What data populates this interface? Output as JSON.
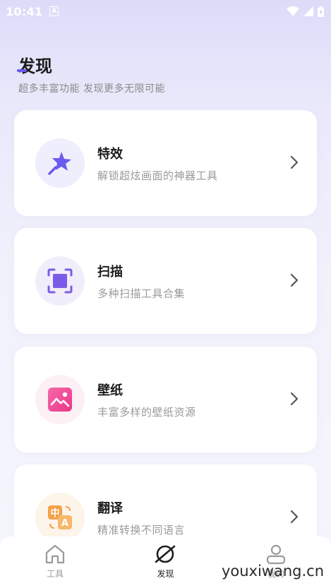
{
  "status_bar": {
    "time": "10:41",
    "notification_badge": "A"
  },
  "header": {
    "title": "发现",
    "subtitle": "超多丰富功能  发现更多无限可能"
  },
  "cards": [
    {
      "title": "特效",
      "description": "解锁超炫画面的神器工具",
      "icon": "magic-wand-star-icon",
      "color": "#6a5bef",
      "bg": "#efeefc"
    },
    {
      "title": "扫描",
      "description": "多种扫描工具合集",
      "icon": "scan-frame-icon",
      "color": "#7a5ce6",
      "bg": "#f1eefb"
    },
    {
      "title": "壁纸",
      "description": "丰富多样的壁纸资源",
      "icon": "wallpaper-image-icon",
      "color": "#f0509a",
      "bg": "#fdf0f4"
    },
    {
      "title": "翻译",
      "description": "精准转换不同语言",
      "icon": "translate-icon",
      "color": "#f3a24a",
      "bg": "#fdf4ea"
    }
  ],
  "nav": [
    {
      "label": "工具",
      "icon": "home-icon",
      "active": false
    },
    {
      "label": "发现",
      "icon": "planet-icon",
      "active": true
    },
    {
      "label": "我的",
      "icon": "profile-icon",
      "active": false
    }
  ],
  "watermark": "youxiwang.cn"
}
